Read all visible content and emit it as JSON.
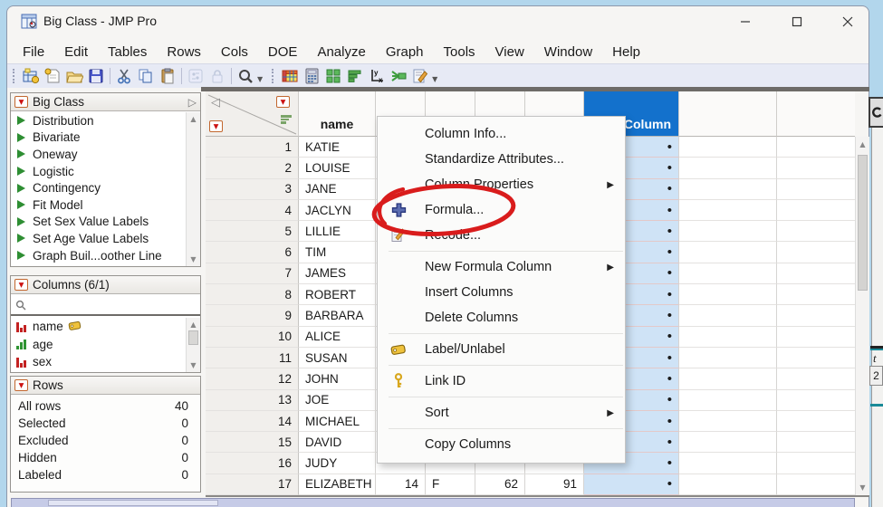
{
  "window": {
    "title": "Big Class - JMP Pro"
  },
  "menu_bar": {
    "items": [
      "File",
      "Edit",
      "Tables",
      "Rows",
      "Cols",
      "DOE",
      "Analyze",
      "Graph",
      "Tools",
      "View",
      "Window",
      "Help"
    ]
  },
  "toolbar": {
    "icons": [
      "new-data-table",
      "new-journal",
      "open",
      "save",
      "cut",
      "copy",
      "paste",
      "column-switcher",
      "lock",
      "search",
      "data-table",
      "calculator",
      "window-panes",
      "graph-builder",
      "fit-y-by-x",
      "join",
      "script-editor"
    ]
  },
  "sidebar": {
    "scripts_panel": {
      "title": "Big Class",
      "items": [
        "Distribution",
        "Bivariate",
        "Oneway",
        "Logistic",
        "Contingency",
        "Fit Model",
        "Set Sex Value Labels",
        "Set Age Value Labels",
        "Graph Buil...oother Line"
      ]
    },
    "columns_panel": {
      "title": "Columns (6/1)",
      "items": [
        {
          "label": "name",
          "icon": "red-bars-icon",
          "labeled": true
        },
        {
          "label": "age",
          "icon": "green-bars-icon",
          "labeled": false
        },
        {
          "label": "sex",
          "icon": "red-bars-icon",
          "labeled": false
        }
      ]
    },
    "rows_panel": {
      "title": "Rows",
      "stats": [
        {
          "label": "All rows",
          "value": "40"
        },
        {
          "label": "Selected",
          "value": "0"
        },
        {
          "label": "Excluded",
          "value": "0"
        },
        {
          "label": "Hidden",
          "value": "0"
        },
        {
          "label": "Labeled",
          "value": "0"
        }
      ]
    }
  },
  "table": {
    "name_header": "name",
    "new_column_header": "Column",
    "missing_marker": "•",
    "rows": [
      {
        "n": "1",
        "name": "KATIE"
      },
      {
        "n": "2",
        "name": "LOUISE"
      },
      {
        "n": "3",
        "name": "JANE"
      },
      {
        "n": "4",
        "name": "JACLYN"
      },
      {
        "n": "5",
        "name": "LILLIE"
      },
      {
        "n": "6",
        "name": "TIM"
      },
      {
        "n": "7",
        "name": "JAMES"
      },
      {
        "n": "8",
        "name": "ROBERT"
      },
      {
        "n": "9",
        "name": "BARBARA"
      },
      {
        "n": "10",
        "name": "ALICE"
      },
      {
        "n": "11",
        "name": "SUSAN"
      },
      {
        "n": "12",
        "name": "JOHN"
      },
      {
        "n": "13",
        "name": "JOE"
      },
      {
        "n": "14",
        "name": "MICHAEL"
      },
      {
        "n": "15",
        "name": "DAVID"
      },
      {
        "n": "16",
        "name": "JUDY"
      },
      {
        "n": "17",
        "name": "ELIZABETH",
        "age": "14",
        "sex": "F",
        "height": "62",
        "weight": "91"
      }
    ]
  },
  "context_menu": {
    "items": [
      {
        "label": "Column Info..."
      },
      {
        "label": "Standardize Attributes..."
      },
      {
        "label": "Column Properties",
        "arrow": true
      },
      {
        "label": "Formula...",
        "icon": "formula-plus-icon",
        "annotated": true
      },
      {
        "label": "Recode...",
        "icon": "recode-pencil-icon"
      },
      {
        "label": "New Formula Column",
        "arrow": true,
        "sep_before": true
      },
      {
        "label": "Insert Columns"
      },
      {
        "label": "Delete Columns"
      },
      {
        "label": "Label/Unlabel",
        "icon": "label-tag-icon",
        "sep_before": true
      },
      {
        "label": "Link ID",
        "icon": "link-key-icon",
        "sep_before": true
      },
      {
        "label": "Sort",
        "arrow": true,
        "sep_before": true
      },
      {
        "label": "Copy Columns",
        "sep_before": true
      }
    ]
  },
  "annotation": {
    "shape": "ellipse",
    "color": "#d91c1c",
    "target": "Formula..."
  },
  "background_window": {
    "partial_text": "t",
    "badge": "2"
  }
}
